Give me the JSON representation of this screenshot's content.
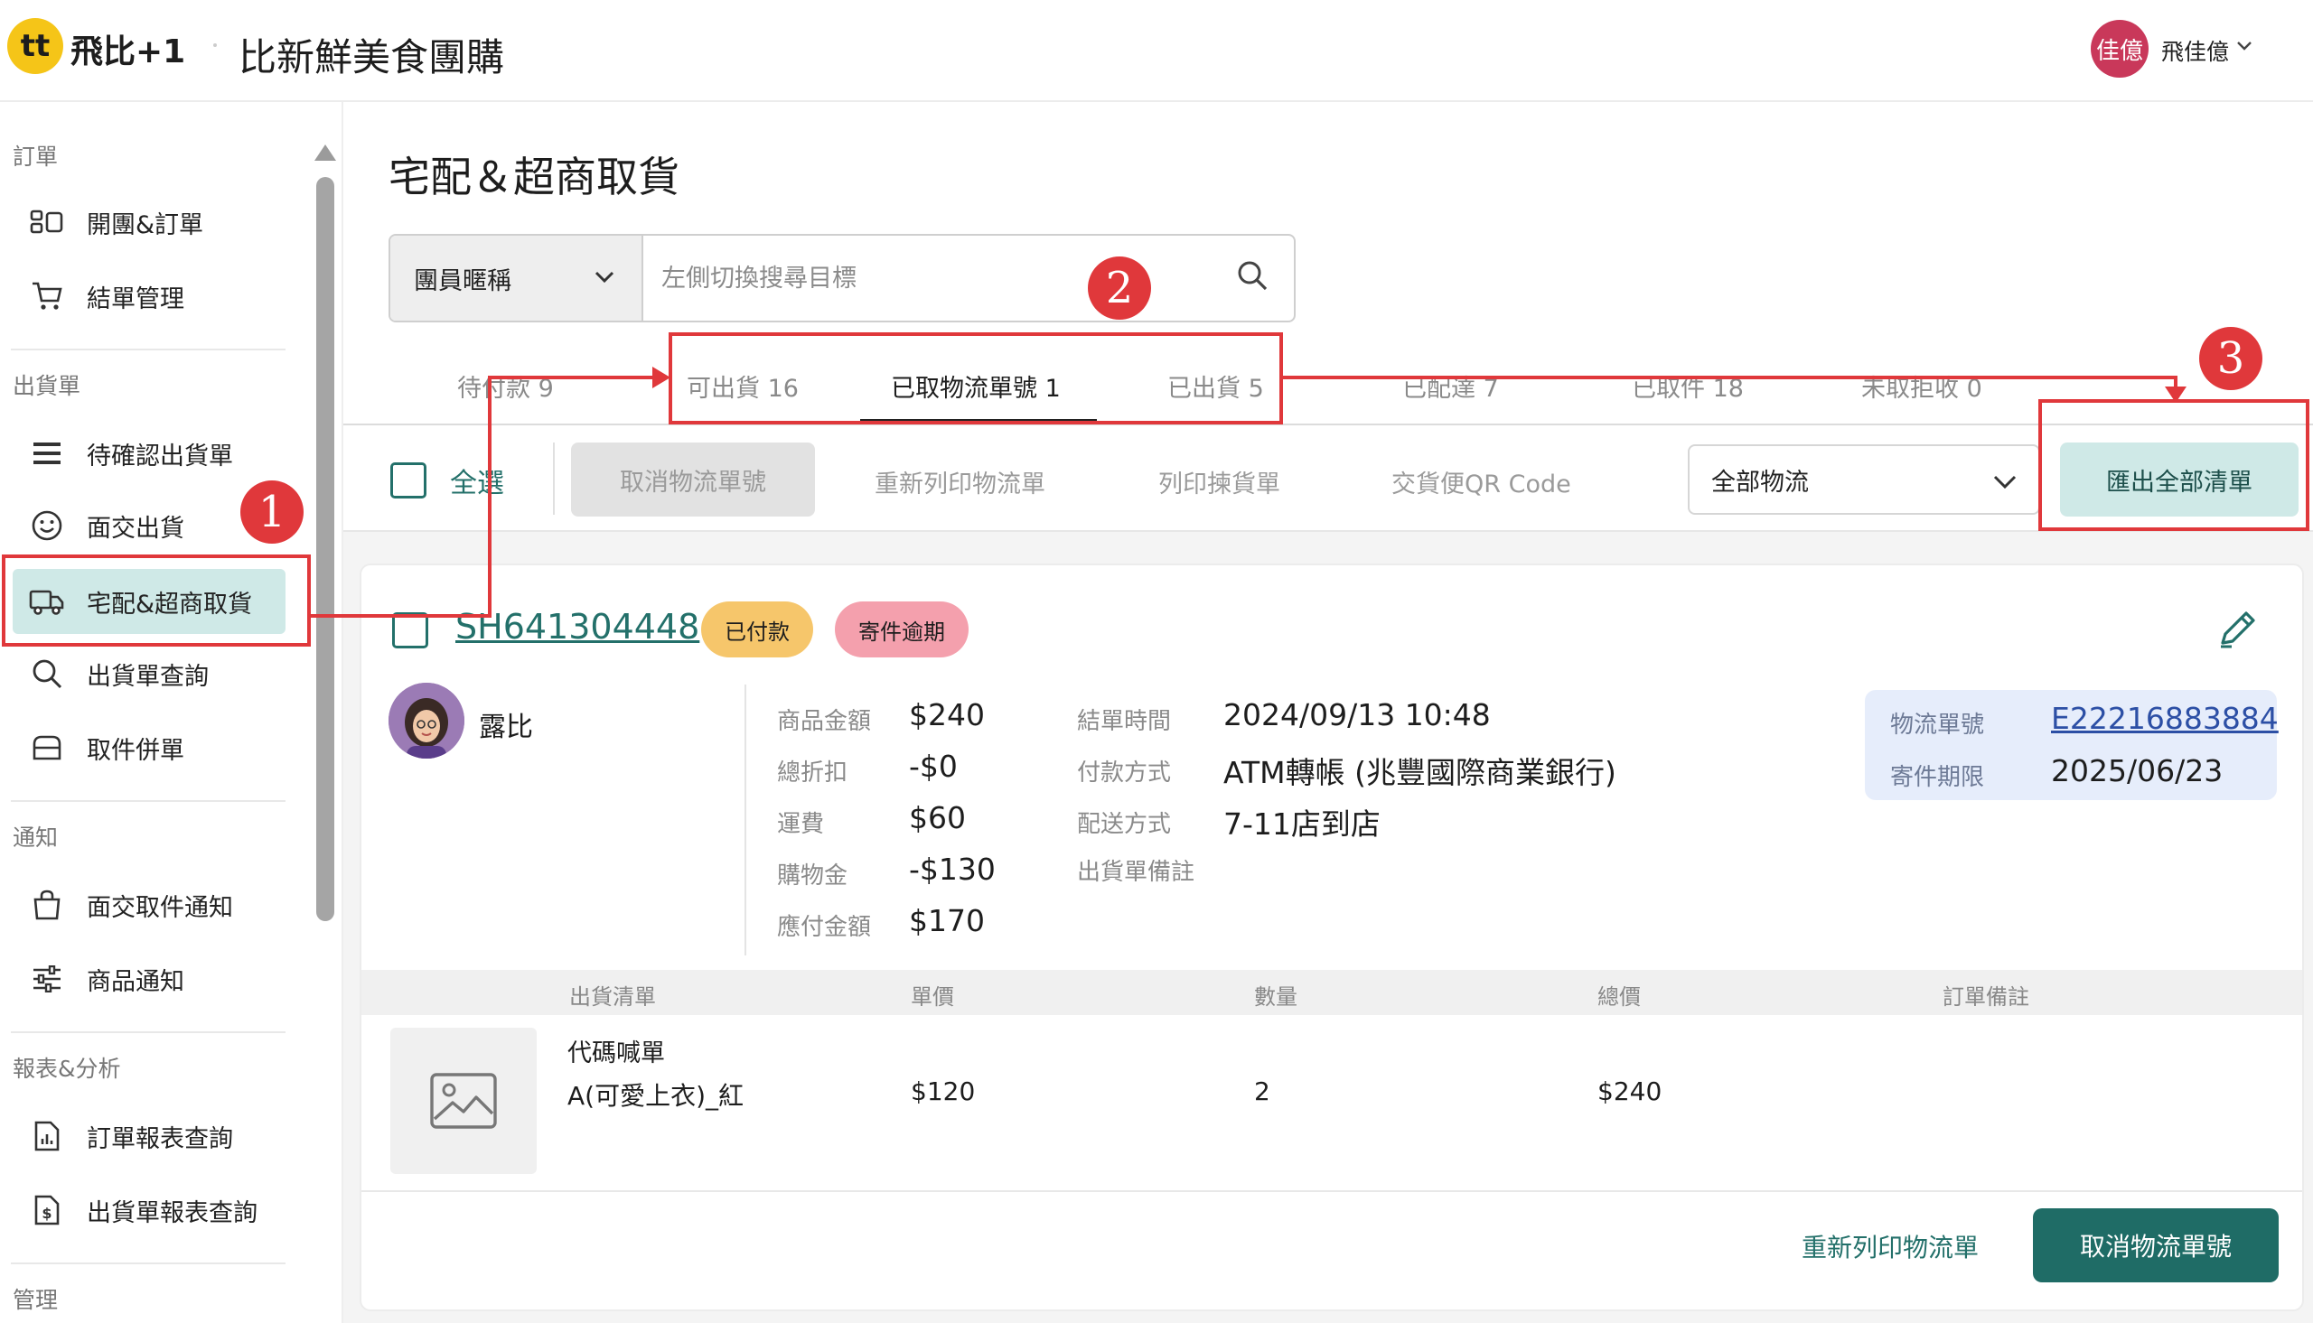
{
  "header": {
    "logo_mark": "tt",
    "logo_text": "飛比+1",
    "shop_name": "比新鮮美食團購",
    "user_avatar": "佳億",
    "user_name": "飛佳億"
  },
  "sidebar": {
    "sections": [
      {
        "title": "訂單",
        "items": [
          {
            "label": "開團&訂單",
            "icon": "group-order-icon"
          },
          {
            "label": "結單管理",
            "icon": "cart-icon"
          }
        ]
      },
      {
        "title": "出貨單",
        "items": [
          {
            "label": "待確認出貨單",
            "icon": "list-icon"
          },
          {
            "label": "面交出貨",
            "icon": "smile-icon"
          },
          {
            "label": "宅配&超商取貨",
            "icon": "truck-icon"
          },
          {
            "label": "出貨單查詢",
            "icon": "search-icon"
          },
          {
            "label": "取件併單",
            "icon": "box-icon"
          }
        ]
      },
      {
        "title": "通知",
        "items": [
          {
            "label": "面交取件通知",
            "icon": "bag-icon"
          },
          {
            "label": "商品通知",
            "icon": "sliders-icon"
          }
        ]
      },
      {
        "title": "報表&分析",
        "items": [
          {
            "label": "訂單報表查詢",
            "icon": "report-icon"
          },
          {
            "label": "出貨單報表查詢",
            "icon": "dollar-report-icon"
          }
        ]
      },
      {
        "title": "管理",
        "items": []
      }
    ]
  },
  "page": {
    "title": "宅配＆超商取貨",
    "search": {
      "select_value": "團員暱稱",
      "placeholder": "左側切換搜尋目標"
    },
    "tabs": [
      "待付款 9",
      "可出貨 16",
      "已取物流單號 1",
      "已出貨 5",
      "已配達 7",
      "已取件 18",
      "未取拒收 0"
    ],
    "toolbar": {
      "select_all": "全選",
      "cancel_tracking": "取消物流單號",
      "reprint": "重新列印物流單",
      "print_picklist": "列印揀貨單",
      "qr_code": "交貨便QR Code",
      "logistics_filter": "全部物流",
      "export_all": "匯出全部清單"
    }
  },
  "order": {
    "id": "SH641304448",
    "badges": [
      "已付款",
      "寄件逾期"
    ],
    "buyer": "露比",
    "amounts": [
      {
        "label": "商品金額",
        "value": "$240"
      },
      {
        "label": "總折扣",
        "value": "-$0"
      },
      {
        "label": "運費",
        "value": "$60"
      },
      {
        "label": "購物金",
        "value": "-$130"
      },
      {
        "label": "應付金額",
        "value": "$170"
      }
    ],
    "info": [
      {
        "label": "結單時間",
        "value": "2024/09/13 10:48"
      },
      {
        "label": "付款方式",
        "value": "ATM轉帳 (兆豐國際商業銀行)"
      },
      {
        "label": "配送方式",
        "value": "7-11店到店"
      },
      {
        "label": "出貨單備註",
        "value": ""
      }
    ],
    "logistics": {
      "no_label": "物流單號",
      "no_value": "E22216883884",
      "deadline_label": "寄件期限",
      "deadline_value": "2025/06/23"
    },
    "items_header": [
      "出貨清單",
      "單價",
      "數量",
      "總價",
      "訂單備註"
    ],
    "items": [
      {
        "code": "代碼喊單",
        "name": "A(可愛上衣)_紅",
        "price": "$120",
        "qty": "2",
        "total": "$240",
        "note": ""
      }
    ],
    "actions": {
      "reprint": "重新列印物流單",
      "cancel": "取消物流單號"
    }
  },
  "annotations": [
    "1",
    "2",
    "3"
  ],
  "colors": {
    "accent": "#23706a",
    "active_bg": "#cfe9e7",
    "annotation": "#e0383b",
    "paid": "#f6c66b",
    "overdue": "#f4a0ad"
  }
}
